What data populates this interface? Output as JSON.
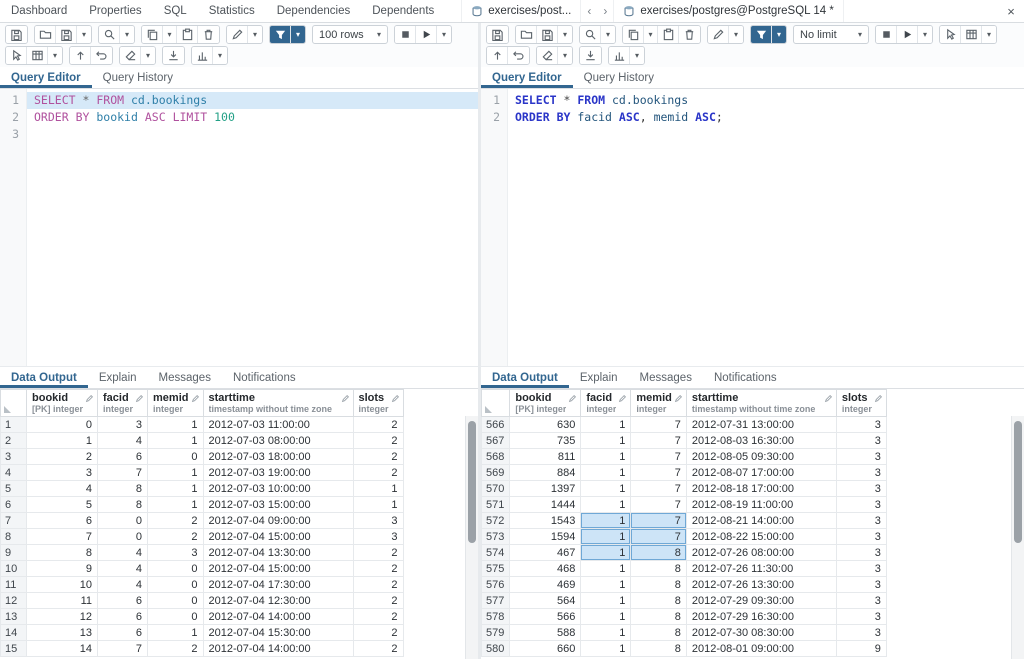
{
  "colors": {
    "accent": "#326690",
    "editor_selection_bg": "#d6e9f8",
    "cell_selected_bg": "#cde4f7",
    "cell_selected_border": "#6fa8d6"
  },
  "topbar": {
    "nav_tabs": [
      "Dashboard",
      "Properties",
      "SQL",
      "Statistics",
      "Dependencies",
      "Dependents"
    ],
    "tab1": "exercises/post...",
    "tab2": "exercises/postgres@PostgreSQL 14 *",
    "scroll_left_glyph": "‹",
    "scroll_right_glyph": "›",
    "close_glyph": "×"
  },
  "columns": [
    {
      "key": "bookid",
      "name": "bookid",
      "sub": "[PK] integer",
      "align": "right"
    },
    {
      "key": "facid",
      "name": "facid",
      "sub": "integer",
      "align": "right"
    },
    {
      "key": "memid",
      "name": "memid",
      "sub": "integer",
      "align": "right"
    },
    {
      "key": "starttime",
      "name": "starttime",
      "sub": "timestamp without time zone",
      "align": "left"
    },
    {
      "key": "slots",
      "name": "slots",
      "sub": "integer",
      "align": "right"
    }
  ],
  "panels": {
    "left": {
      "limit": "100 rows",
      "editor_tabs": [
        {
          "label": "Query Editor",
          "active": true
        },
        {
          "label": "Query History",
          "active": false
        }
      ],
      "selected_line": 1,
      "code": [
        [
          [
            "kw",
            "SELECT"
          ],
          [
            "pl",
            " "
          ],
          [
            "op",
            "*"
          ],
          [
            "pl",
            " "
          ],
          [
            "kw",
            "FROM"
          ],
          [
            "pl",
            " "
          ],
          [
            "id",
            "cd.bookings"
          ]
        ],
        [
          [
            "kw",
            "ORDER"
          ],
          [
            "pl",
            " "
          ],
          [
            "kw",
            "BY"
          ],
          [
            "pl",
            " "
          ],
          [
            "id",
            "bookid"
          ],
          [
            "pl",
            " "
          ],
          [
            "kw",
            "ASC"
          ],
          [
            "pl",
            " "
          ],
          [
            "kw",
            "LIMIT"
          ],
          [
            "pl",
            " "
          ],
          [
            "num",
            "100"
          ]
        ],
        []
      ],
      "result_tabs": [
        {
          "label": "Data Output",
          "active": true
        },
        {
          "label": "Explain",
          "active": false
        },
        {
          "label": "Messages",
          "active": false
        },
        {
          "label": "Notifications",
          "active": false
        }
      ],
      "rows": [
        [
          1,
          0,
          3,
          1,
          "2012-07-03 11:00:00",
          2
        ],
        [
          2,
          1,
          4,
          1,
          "2012-07-03 08:00:00",
          2
        ],
        [
          3,
          2,
          6,
          0,
          "2012-07-03 18:00:00",
          2
        ],
        [
          4,
          3,
          7,
          1,
          "2012-07-03 19:00:00",
          2
        ],
        [
          5,
          4,
          8,
          1,
          "2012-07-03 10:00:00",
          1
        ],
        [
          6,
          5,
          8,
          1,
          "2012-07-03 15:00:00",
          1
        ],
        [
          7,
          6,
          0,
          2,
          "2012-07-04 09:00:00",
          3
        ],
        [
          8,
          7,
          0,
          2,
          "2012-07-04 15:00:00",
          3
        ],
        [
          9,
          8,
          4,
          3,
          "2012-07-04 13:30:00",
          2
        ],
        [
          10,
          9,
          4,
          0,
          "2012-07-04 15:00:00",
          2
        ],
        [
          11,
          10,
          4,
          0,
          "2012-07-04 17:30:00",
          2
        ],
        [
          12,
          11,
          6,
          0,
          "2012-07-04 12:30:00",
          2
        ],
        [
          13,
          12,
          6,
          0,
          "2012-07-04 14:00:00",
          2
        ],
        [
          14,
          13,
          6,
          1,
          "2012-07-04 15:30:00",
          2
        ],
        [
          15,
          14,
          7,
          2,
          "2012-07-04 14:00:00",
          2
        ]
      ],
      "selection": null,
      "toolbar_rows": [
        [
          [
            {
              "n": "save-data-button",
              "i": "save"
            }
          ],
          [
            {
              "n": "open-file-button",
              "i": "folder"
            },
            {
              "n": "save-file-button",
              "i": "save"
            },
            {
              "n": "save-file-menu-button",
              "i": "caret"
            }
          ],
          [
            {
              "n": "find-button",
              "i": "search"
            },
            {
              "n": "find-menu-button",
              "i": "caret"
            }
          ],
          [
            {
              "n": "copy-button",
              "i": "copy"
            },
            {
              "n": "copy-menu-button",
              "i": "caret"
            },
            {
              "n": "paste-button",
              "i": "paste"
            },
            {
              "n": "delete-button",
              "i": "trash"
            }
          ],
          [
            {
              "n": "edit-button",
              "i": "pencil"
            },
            {
              "n": "edit-menu-button",
              "i": "caret"
            }
          ],
          [
            {
              "n": "filter-button",
              "i": "funnel",
              "p": true
            },
            {
              "n": "filter-menu-button",
              "i": "caret",
              "p": true
            }
          ],
          [
            {
              "n": "row-limit-select",
              "sel": true
            }
          ],
          [
            {
              "n": "cancel-query-button",
              "i": "stop"
            },
            {
              "n": "execute-button",
              "i": "play"
            },
            {
              "n": "execute-menu-button",
              "i": "caret"
            }
          ]
        ],
        [
          [
            {
              "n": "pointer-mode-button",
              "i": "cursor"
            },
            {
              "n": "table-options-button",
              "i": "table"
            },
            {
              "n": "table-options-menu-button",
              "i": "caret"
            }
          ],
          [
            {
              "n": "commit-button",
              "i": "commit"
            },
            {
              "n": "rollback-button",
              "i": "rollback"
            }
          ],
          [
            {
              "n": "clear-button",
              "i": "eraser"
            },
            {
              "n": "clear-menu-button",
              "i": "caret"
            }
          ],
          [
            {
              "n": "download-results-button",
              "i": "download"
            }
          ],
          [
            {
              "n": "graph-visualiser-button",
              "i": "chart"
            },
            {
              "n": "graph-visualiser-menu-button",
              "i": "caret"
            }
          ]
        ]
      ]
    },
    "right": {
      "limit": "No limit",
      "editor_tabs": [
        {
          "label": "Query Editor",
          "active": true
        },
        {
          "label": "Query History",
          "active": false
        }
      ],
      "selected_line": null,
      "code": [
        [
          [
            "kw",
            "SELECT"
          ],
          [
            "pl",
            " "
          ],
          [
            "op",
            "*"
          ],
          [
            "pl",
            " "
          ],
          [
            "kw",
            "FROM"
          ],
          [
            "pl",
            " "
          ],
          [
            "id",
            "cd.bookings"
          ]
        ],
        [
          [
            "kw",
            "ORDER"
          ],
          [
            "pl",
            " "
          ],
          [
            "kw",
            "BY"
          ],
          [
            "pl",
            " "
          ],
          [
            "id",
            "facid"
          ],
          [
            "pl",
            " "
          ],
          [
            "kw",
            "ASC"
          ],
          [
            "pl",
            ", "
          ],
          [
            "id",
            "memid"
          ],
          [
            "pl",
            " "
          ],
          [
            "kw",
            "ASC"
          ],
          [
            "pl",
            ";"
          ]
        ]
      ],
      "result_tabs": [
        {
          "label": "Data Output",
          "active": true
        },
        {
          "label": "Explain",
          "active": false
        },
        {
          "label": "Messages",
          "active": false
        },
        {
          "label": "Notifications",
          "active": false
        }
      ],
      "rows": [
        [
          566,
          630,
          1,
          7,
          "2012-07-31 13:00:00",
          3
        ],
        [
          567,
          735,
          1,
          7,
          "2012-08-03 16:30:00",
          3
        ],
        [
          568,
          811,
          1,
          7,
          "2012-08-05 09:30:00",
          3
        ],
        [
          569,
          884,
          1,
          7,
          "2012-08-07 17:00:00",
          3
        ],
        [
          570,
          1397,
          1,
          7,
          "2012-08-18 17:00:00",
          3
        ],
        [
          571,
          1444,
          1,
          7,
          "2012-08-19 11:00:00",
          3
        ],
        [
          572,
          1543,
          1,
          7,
          "2012-08-21 14:00:00",
          3
        ],
        [
          573,
          1594,
          1,
          7,
          "2012-08-22 15:00:00",
          3
        ],
        [
          574,
          467,
          1,
          8,
          "2012-07-26 08:00:00",
          3
        ],
        [
          575,
          468,
          1,
          8,
          "2012-07-26 11:30:00",
          3
        ],
        [
          576,
          469,
          1,
          8,
          "2012-07-26 13:30:00",
          3
        ],
        [
          577,
          564,
          1,
          8,
          "2012-07-29 09:30:00",
          3
        ],
        [
          578,
          566,
          1,
          8,
          "2012-07-29 16:30:00",
          3
        ],
        [
          579,
          588,
          1,
          8,
          "2012-07-30 08:30:00",
          3
        ],
        [
          580,
          660,
          1,
          8,
          "2012-08-01 09:00:00",
          9
        ]
      ],
      "selection": {
        "rows": [
          572,
          573,
          574
        ],
        "cols": [
          "facid",
          "memid"
        ]
      },
      "toolbar_rows": [
        [
          [
            {
              "n": "save-data-button",
              "i": "save"
            }
          ],
          [
            {
              "n": "open-file-button",
              "i": "folder"
            },
            {
              "n": "save-file-button",
              "i": "save"
            },
            {
              "n": "save-file-menu-button",
              "i": "caret"
            }
          ],
          [
            {
              "n": "find-button",
              "i": "search"
            },
            {
              "n": "find-menu-button",
              "i": "caret"
            }
          ],
          [
            {
              "n": "copy-button",
              "i": "copy"
            },
            {
              "n": "copy-menu-button",
              "i": "caret"
            },
            {
              "n": "paste-button",
              "i": "paste"
            },
            {
              "n": "delete-button",
              "i": "trash"
            }
          ],
          [
            {
              "n": "edit-button",
              "i": "pencil"
            },
            {
              "n": "edit-menu-button",
              "i": "caret"
            }
          ],
          [
            {
              "n": "filter-button",
              "i": "funnel",
              "p": true
            },
            {
              "n": "filter-menu-button",
              "i": "caret",
              "p": true
            }
          ],
          [
            {
              "n": "row-limit-select",
              "sel": true
            }
          ],
          [
            {
              "n": "cancel-query-button",
              "i": "stop"
            },
            {
              "n": "execute-button",
              "i": "play"
            },
            {
              "n": "execute-menu-button",
              "i": "caret"
            }
          ],
          [
            {
              "n": "pointer-mode-button",
              "i": "cursor"
            },
            {
              "n": "table-options-button",
              "i": "table"
            },
            {
              "n": "table-options-menu-button",
              "i": "caret"
            }
          ]
        ],
        [
          [
            {
              "n": "commit-button",
              "i": "commit"
            },
            {
              "n": "rollback-button",
              "i": "rollback"
            }
          ],
          [
            {
              "n": "clear-button",
              "i": "eraser"
            },
            {
              "n": "clear-menu-button",
              "i": "caret"
            }
          ],
          [
            {
              "n": "download-results-button",
              "i": "download"
            }
          ],
          [
            {
              "n": "graph-visualiser-button",
              "i": "chart"
            },
            {
              "n": "graph-visualiser-menu-button",
              "i": "caret"
            }
          ]
        ]
      ]
    }
  }
}
